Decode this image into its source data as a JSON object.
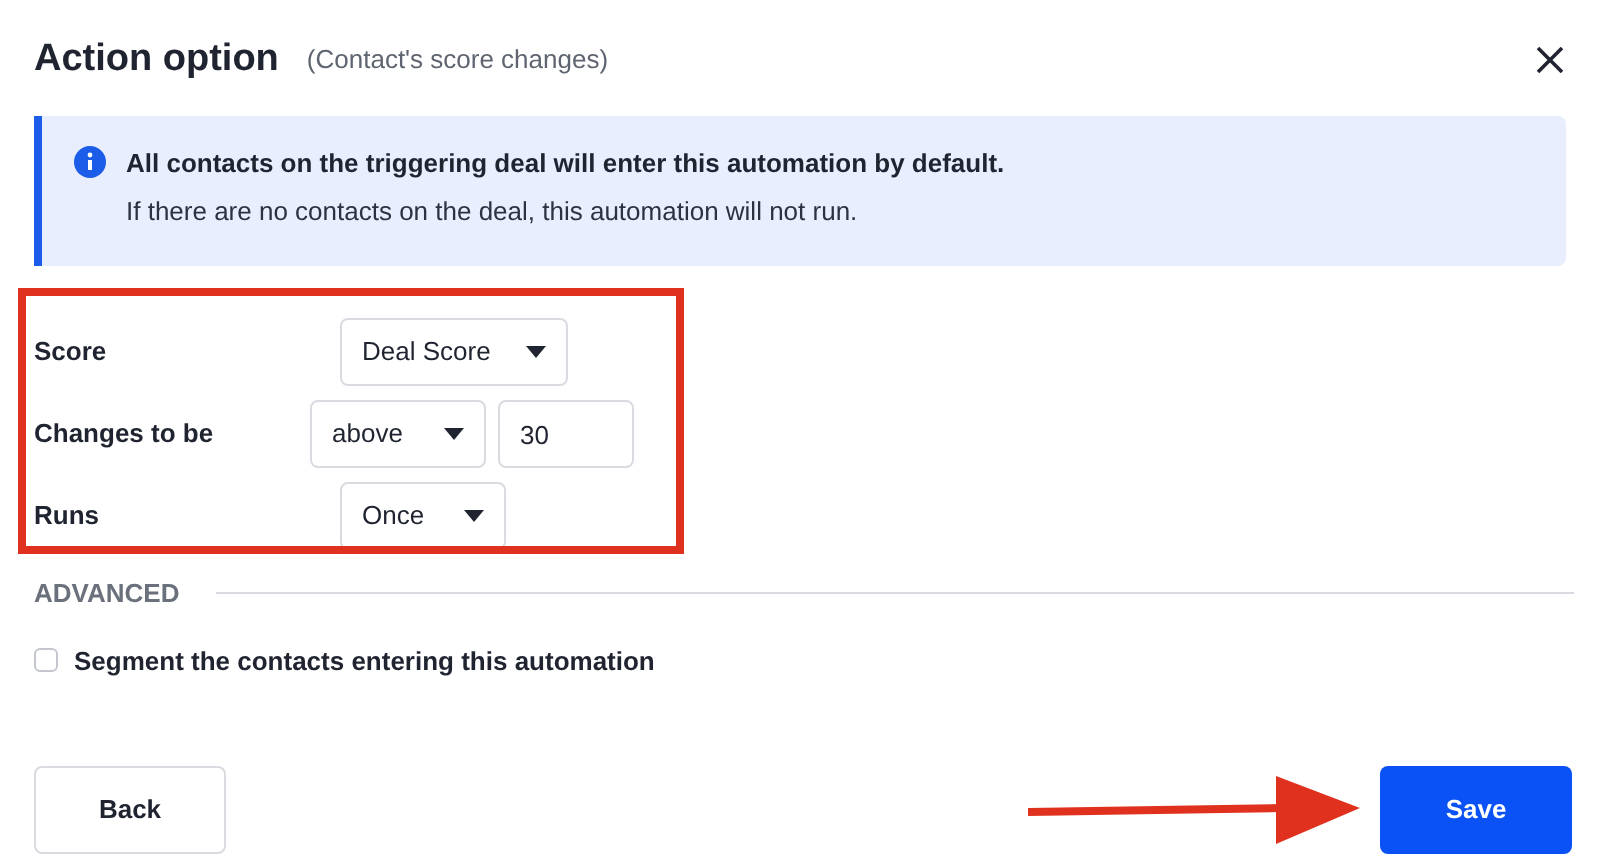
{
  "dialog": {
    "title": "Action option",
    "subtitle": "(Contact's score changes)"
  },
  "info": {
    "heading": "All contacts on the triggering deal will enter this automation by default.",
    "text": "If there are no contacts on the deal, this automation will not run."
  },
  "fields": [
    {
      "label": "Score",
      "controls": [
        {
          "kind": "select",
          "value": "Deal Score"
        }
      ]
    },
    {
      "label": "Changes to be",
      "controls": [
        {
          "kind": "select",
          "value": "above"
        },
        {
          "kind": "input",
          "value": "30"
        }
      ]
    },
    {
      "label": "Runs",
      "controls": [
        {
          "kind": "select",
          "value": "Once"
        }
      ]
    }
  ],
  "advanced": {
    "label": "ADVANCED",
    "checkbox": {
      "label": "Segment the contacts entering this automation",
      "checked": false
    }
  },
  "buttons": [
    {
      "label": "Back",
      "kind": "secondary"
    },
    {
      "label": "Save",
      "kind": "primary"
    }
  ]
}
